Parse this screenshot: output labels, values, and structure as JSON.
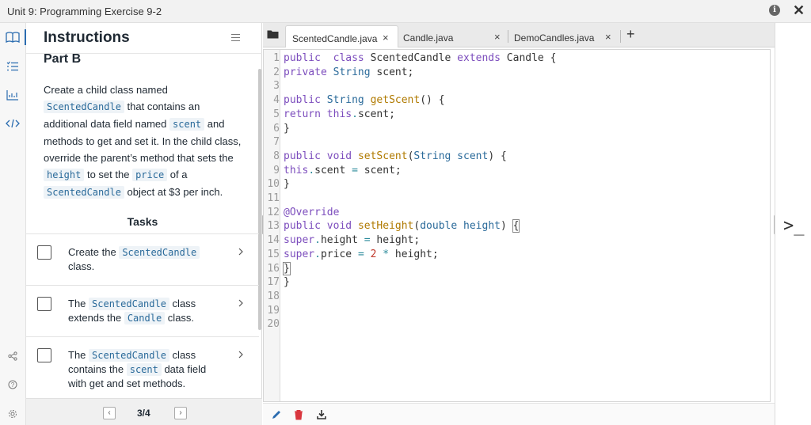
{
  "window": {
    "title": "Unit 9: Programming Exercise 9-2"
  },
  "instructions": {
    "heading": "Instructions",
    "part_title": "Part B",
    "para": [
      {
        "t": "Create a child class named "
      },
      {
        "c": "ScentedCandle"
      },
      {
        "t": " that contains an additional data field named "
      },
      {
        "c": "scent"
      },
      {
        "t": " and methods to get and set it. In the child class, override the parent’s method that sets the "
      },
      {
        "c": "height"
      },
      {
        "t": " to set the "
      },
      {
        "c": "price"
      },
      {
        "t": " of a "
      },
      {
        "c": "ScentedCandle"
      },
      {
        "t": " object at $3 per inch."
      }
    ],
    "tasks_title": "Tasks",
    "tasks": [
      {
        "parts": [
          {
            "t": "Create the "
          },
          {
            "c": "ScentedCandle"
          },
          {
            "t": " class."
          }
        ]
      },
      {
        "parts": [
          {
            "t": "The "
          },
          {
            "c": "ScentedCandle"
          },
          {
            "t": " class extends the "
          },
          {
            "c": "Candle"
          },
          {
            "t": " class."
          }
        ]
      },
      {
        "parts": [
          {
            "t": "The "
          },
          {
            "c": "ScentedCandle"
          },
          {
            "t": " class contains the "
          },
          {
            "c": "scent"
          },
          {
            "t": " data field with get and set methods."
          }
        ]
      }
    ],
    "pager": {
      "prev": "‹",
      "next": "›",
      "page": "3/4"
    }
  },
  "tabs": [
    {
      "label": "ScentedCandle.java",
      "close": "×",
      "active": true
    },
    {
      "label": "Candle.java",
      "close": "×",
      "active": false
    },
    {
      "label": "DemoCandles.java",
      "close": "×",
      "active": false
    }
  ],
  "tab_add": "+",
  "line_numbers": [
    "1",
    "2",
    "3",
    "4",
    "5",
    "6",
    "7",
    "8",
    "9",
    "10",
    "11",
    "12",
    "13",
    "14",
    "15",
    "16",
    "17",
    "18",
    "19",
    "20"
  ],
  "code_lines": [
    [
      [
        "kw",
        "public"
      ],
      [
        "",
        "  "
      ],
      [
        "kw",
        "class"
      ],
      [
        "",
        " ScentedCandle "
      ],
      [
        "kw",
        "extends"
      ],
      [
        "",
        " Candle {"
      ]
    ],
    [
      [
        "kw",
        "private"
      ],
      [
        "",
        ""
      ],
      [
        "ty",
        " String"
      ],
      [
        "",
        " scent;"
      ]
    ],
    [],
    [
      [
        "kw",
        "public"
      ],
      [
        "ty",
        " String"
      ],
      [
        "",
        " "
      ],
      [
        "fn",
        "getScent"
      ],
      [
        "",
        "() {"
      ]
    ],
    [
      [
        "kw",
        "return"
      ],
      [
        "",
        " "
      ],
      [
        "kw",
        "this"
      ],
      [
        "op",
        "."
      ],
      [
        "",
        "scent;"
      ]
    ],
    [
      [
        "",
        "}"
      ]
    ],
    [],
    [
      [
        "kw",
        "public"
      ],
      [
        "kw",
        " void"
      ],
      [
        "",
        " "
      ],
      [
        "fn",
        "setScent"
      ],
      [
        "",
        "("
      ],
      [
        "ty",
        "String"
      ],
      [
        "ty",
        " scent"
      ],
      [
        "",
        ") {"
      ]
    ],
    [
      [
        "kw",
        "this"
      ],
      [
        "op",
        "."
      ],
      [
        "",
        "scent "
      ],
      [
        "op",
        "="
      ],
      [
        "",
        " scent;"
      ]
    ],
    [
      [
        "",
        "}"
      ]
    ],
    [],
    [
      [
        "an",
        "@Override"
      ]
    ],
    [
      [
        "kw",
        "public"
      ],
      [
        "kw",
        " void"
      ],
      [
        "",
        " "
      ],
      [
        "fn",
        "setHeight"
      ],
      [
        "",
        "("
      ],
      [
        "ty",
        "double"
      ],
      [
        "ty",
        " height"
      ],
      [
        "",
        ") "
      ],
      [
        "bx",
        "{"
      ]
    ],
    [
      [
        "kw",
        "super"
      ],
      [
        "op",
        "."
      ],
      [
        "",
        "height "
      ],
      [
        "op",
        "="
      ],
      [
        "",
        " height;"
      ]
    ],
    [
      [
        "kw",
        "super"
      ],
      [
        "op",
        "."
      ],
      [
        "",
        "price "
      ],
      [
        "op",
        "="
      ],
      [
        "",
        " "
      ],
      [
        "nm",
        "2"
      ],
      [
        "",
        " "
      ],
      [
        "op",
        "*"
      ],
      [
        "",
        " height;"
      ]
    ],
    [
      [
        "bx",
        "}"
      ]
    ],
    [
      [
        "",
        "}"
      ]
    ],
    [],
    [],
    []
  ],
  "console": {
    "prompt": ">_"
  },
  "colors": {
    "accent": "#2b6cb0",
    "keyword": "#7c4dbd",
    "type": "#2a6a9a",
    "method": "#b07a00",
    "number": "#c0392b"
  },
  "icons": {
    "rail": [
      "book-icon",
      "checklist-icon",
      "chart-icon",
      "code-icon",
      "share-icon",
      "help-icon",
      "settings-icon"
    ],
    "bottom": [
      "pencil-icon",
      "trash-icon",
      "download-icon"
    ]
  }
}
